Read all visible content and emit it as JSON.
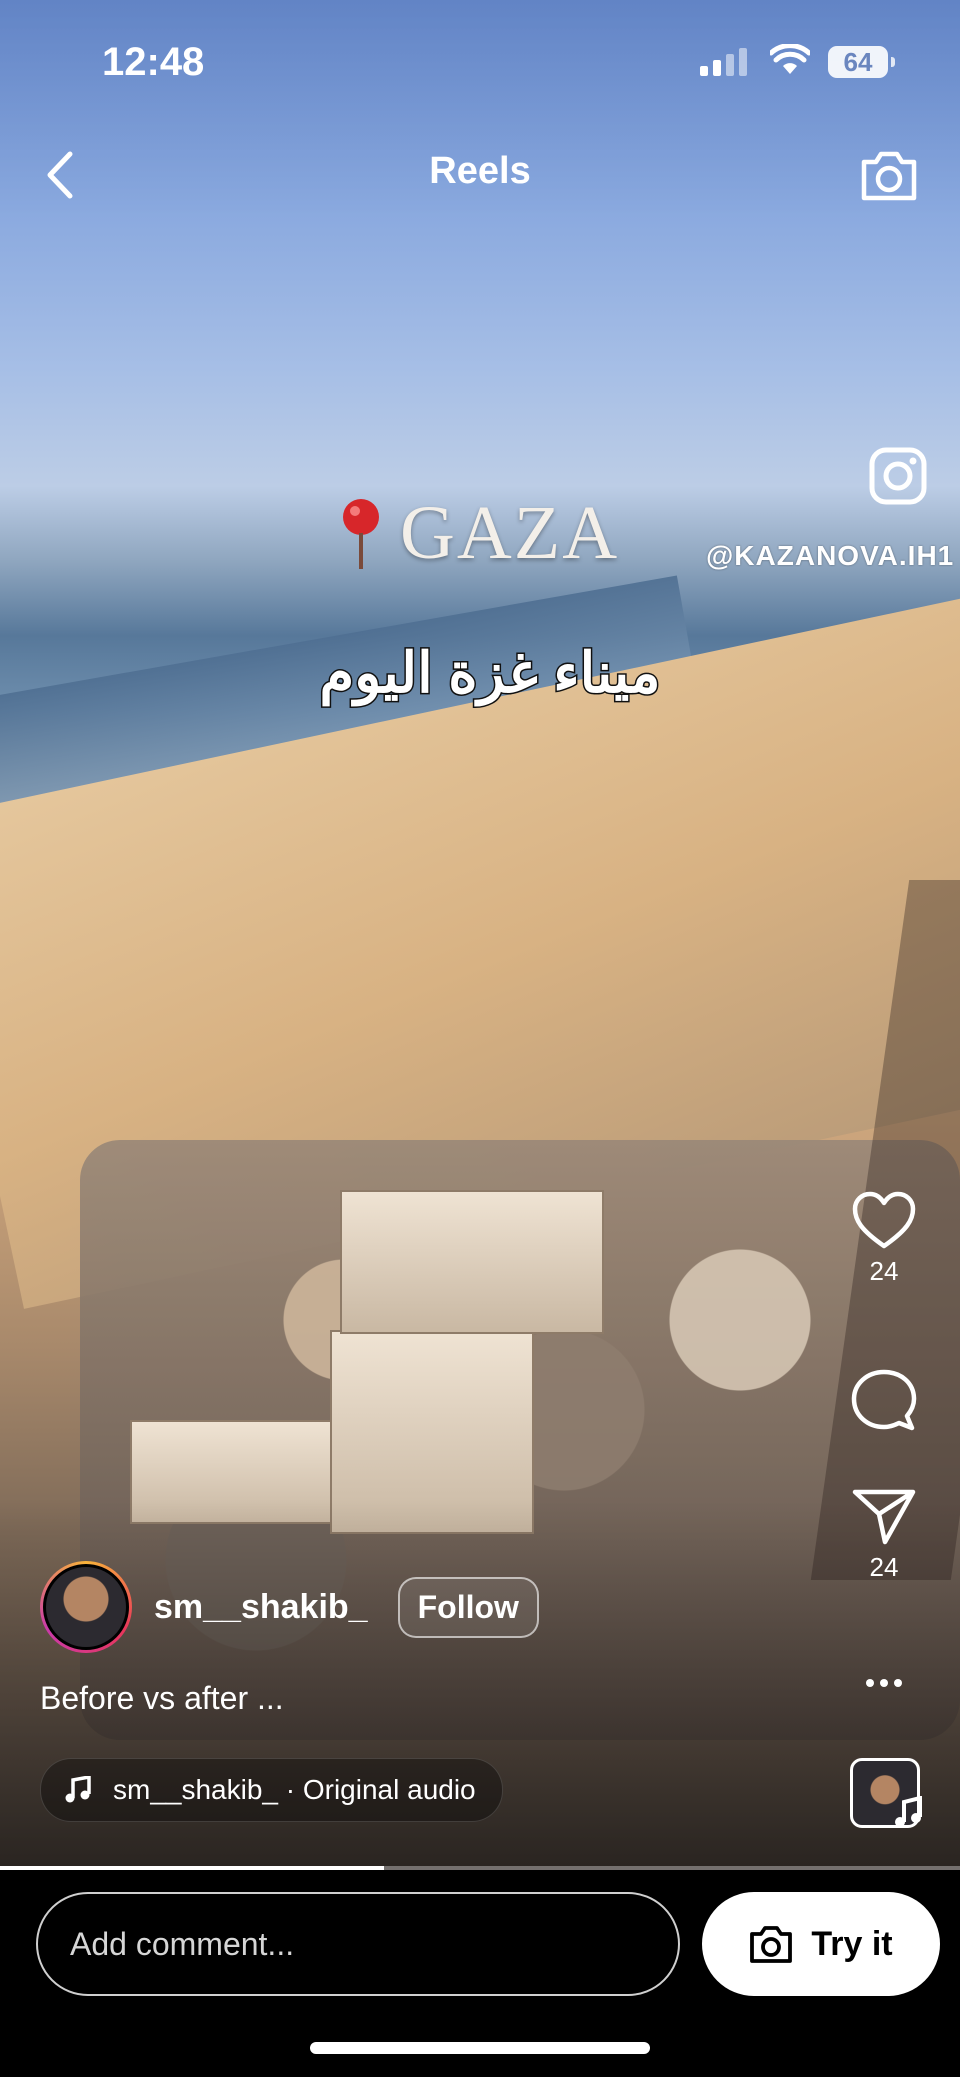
{
  "status_bar": {
    "time": "12:48",
    "battery": "64"
  },
  "header": {
    "title": "Reels"
  },
  "video": {
    "watermark": "@KAZANOVA.IH1",
    "place_label": "GAZA",
    "arabic_caption": "ميناء غزة اليوم"
  },
  "actions": {
    "likes": "24",
    "shares": "24"
  },
  "author": {
    "username": "sm__shakib_",
    "follow_label": "Follow"
  },
  "caption": "Before vs after ...",
  "audio": {
    "label": "sm__shakib_ · Original audio"
  },
  "progress": {
    "fraction": 0.4
  },
  "comment": {
    "placeholder": "Add comment..."
  },
  "try_it": {
    "label": "Try it"
  },
  "colors": {
    "background": "#000000",
    "accent_ring": "#e8365a",
    "text": "#ffffff"
  },
  "icons": [
    "back-icon",
    "camera-icon",
    "instagram-logo-icon",
    "location-pin-icon",
    "heart-icon",
    "comment-icon",
    "send-icon",
    "more-icon",
    "music-note-icon"
  ]
}
